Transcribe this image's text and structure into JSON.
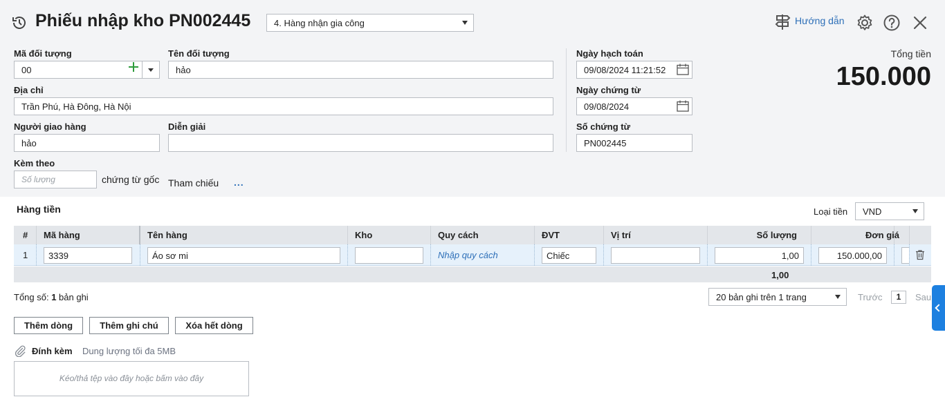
{
  "header": {
    "title": "Phiếu nhập kho PN002445",
    "type_selected": "4. Hàng nhận gia công",
    "help_label": "Hướng dẫn"
  },
  "form": {
    "object_code_label": "Mã đối tượng",
    "object_code": "00",
    "object_name_label": "Tên đối tượng",
    "object_name": "hảo",
    "address_label": "Địa chỉ",
    "address": "Trần Phú, Hà Đông, Hà Nội",
    "deliverer_label": "Người giao hàng",
    "deliverer": "hảo",
    "description_label": "Diễn giải",
    "description": "",
    "attached_label": "Kèm theo",
    "attached_placeholder": "Số lượng",
    "original_docs": "chứng từ gốc",
    "reference": "Tham chiếu",
    "reference_more": "...",
    "posting_date_label": "Ngày hạch toán",
    "posting_date": "09/08/2024 11:21:52",
    "doc_date_label": "Ngày chứng từ",
    "doc_date": "09/08/2024",
    "doc_number_label": "Số chứng từ",
    "doc_number": "PN002445"
  },
  "total": {
    "label": "Tổng tiền",
    "value": "150.000"
  },
  "grid": {
    "section_title": "Hàng tiền",
    "currency_label": "Loại tiền",
    "currency": "VND",
    "columns": [
      "#",
      "Mã hàng",
      "Tên hàng",
      "Kho",
      "Quy cách",
      "ĐVT",
      "Vị trí",
      "Số lượng",
      "Đơn giá"
    ],
    "rows": [
      {
        "index": "1",
        "code": "3339",
        "name": "Áo sơ mi",
        "warehouse": "",
        "spec": "Nhập quy cách",
        "unit": "Chiếc",
        "location": "",
        "quantity": "1,00",
        "price": "150.000,00"
      }
    ],
    "footer_quantity": "1,00"
  },
  "pagination": {
    "total_prefix": "Tổng số: ",
    "total_count": "1",
    "total_suffix": " bản ghi",
    "page_size": "20 bản ghi trên 1 trang",
    "prev": "Trước",
    "page": "1",
    "next": "Sau"
  },
  "actions": {
    "add_row": "Thêm dòng",
    "add_note": "Thêm ghi chú",
    "clear_rows": "Xóa hết dòng"
  },
  "attachments": {
    "label": "Đính kèm",
    "hint": "Dung lượng tối đa 5MB",
    "dropzone": "Kéo/thả tệp vào đây hoặc bấm vào đây"
  },
  "icons": {
    "history": "history-icon",
    "help": "signpost-icon",
    "settings": "gear-icon",
    "question": "question-icon",
    "close": "close-icon",
    "calendar": "calendar-icon",
    "trash": "trash-icon",
    "attach": "paperclip-icon",
    "add": "plus-icon"
  },
  "colors": {
    "link": "#2d6fb8",
    "add": "#2e9b3c",
    "side_tab": "#1d80e0",
    "row_highlight": "#e6f1fb"
  }
}
